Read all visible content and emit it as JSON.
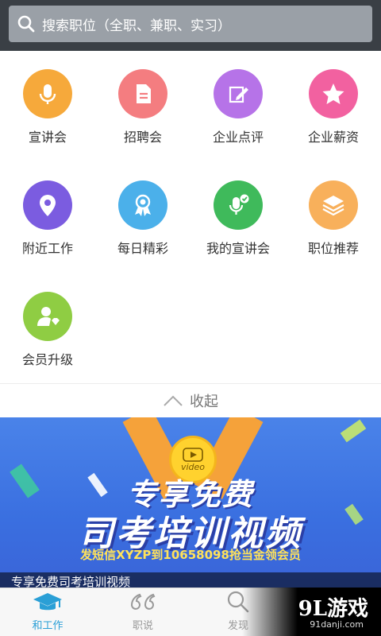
{
  "search": {
    "placeholder": "搜索职位（全职、兼职、实习）"
  },
  "grid": {
    "items": [
      {
        "label": "宣讲会",
        "icon": "microphone-icon",
        "color": "#f6a93b"
      },
      {
        "label": "招聘会",
        "icon": "document-icon",
        "color": "#f47d80"
      },
      {
        "label": "企业点评",
        "icon": "edit-icon",
        "color": "#b673e8"
      },
      {
        "label": "企业薪资",
        "icon": "star-icon",
        "color": "#f261a0"
      },
      {
        "label": "附近工作",
        "icon": "location-pin-icon",
        "color": "#7b5ce0"
      },
      {
        "label": "每日精彩",
        "icon": "ribbon-badge-icon",
        "color": "#4bb0ea"
      },
      {
        "label": "我的宣讲会",
        "icon": "microphone-check-icon",
        "color": "#3fba5b"
      },
      {
        "label": "职位推荐",
        "icon": "layers-icon",
        "color": "#f8b05b"
      },
      {
        "label": "会员升级",
        "icon": "user-diamond-icon",
        "color": "#8fcd43"
      }
    ]
  },
  "collapse": {
    "label": "收起"
  },
  "banner": {
    "medal_text": "video",
    "line1": "专享免费",
    "line2": "司考培训视频",
    "line3": "发短信XYZP到10658098抢当金领会员",
    "caption": "专享免费司考培训视频"
  },
  "bottom_nav": {
    "items": [
      {
        "label": "和工作",
        "icon": "graduation-cap-icon",
        "active": true
      },
      {
        "label": "职说",
        "icon": "quote-icon",
        "active": false
      },
      {
        "label": "发现",
        "icon": "search-icon",
        "active": false
      }
    ],
    "active_color": "#2a9fd6",
    "inactive_color": "#999999"
  },
  "watermark": {
    "brand": "9L游戏",
    "domain": "91danji.com"
  }
}
